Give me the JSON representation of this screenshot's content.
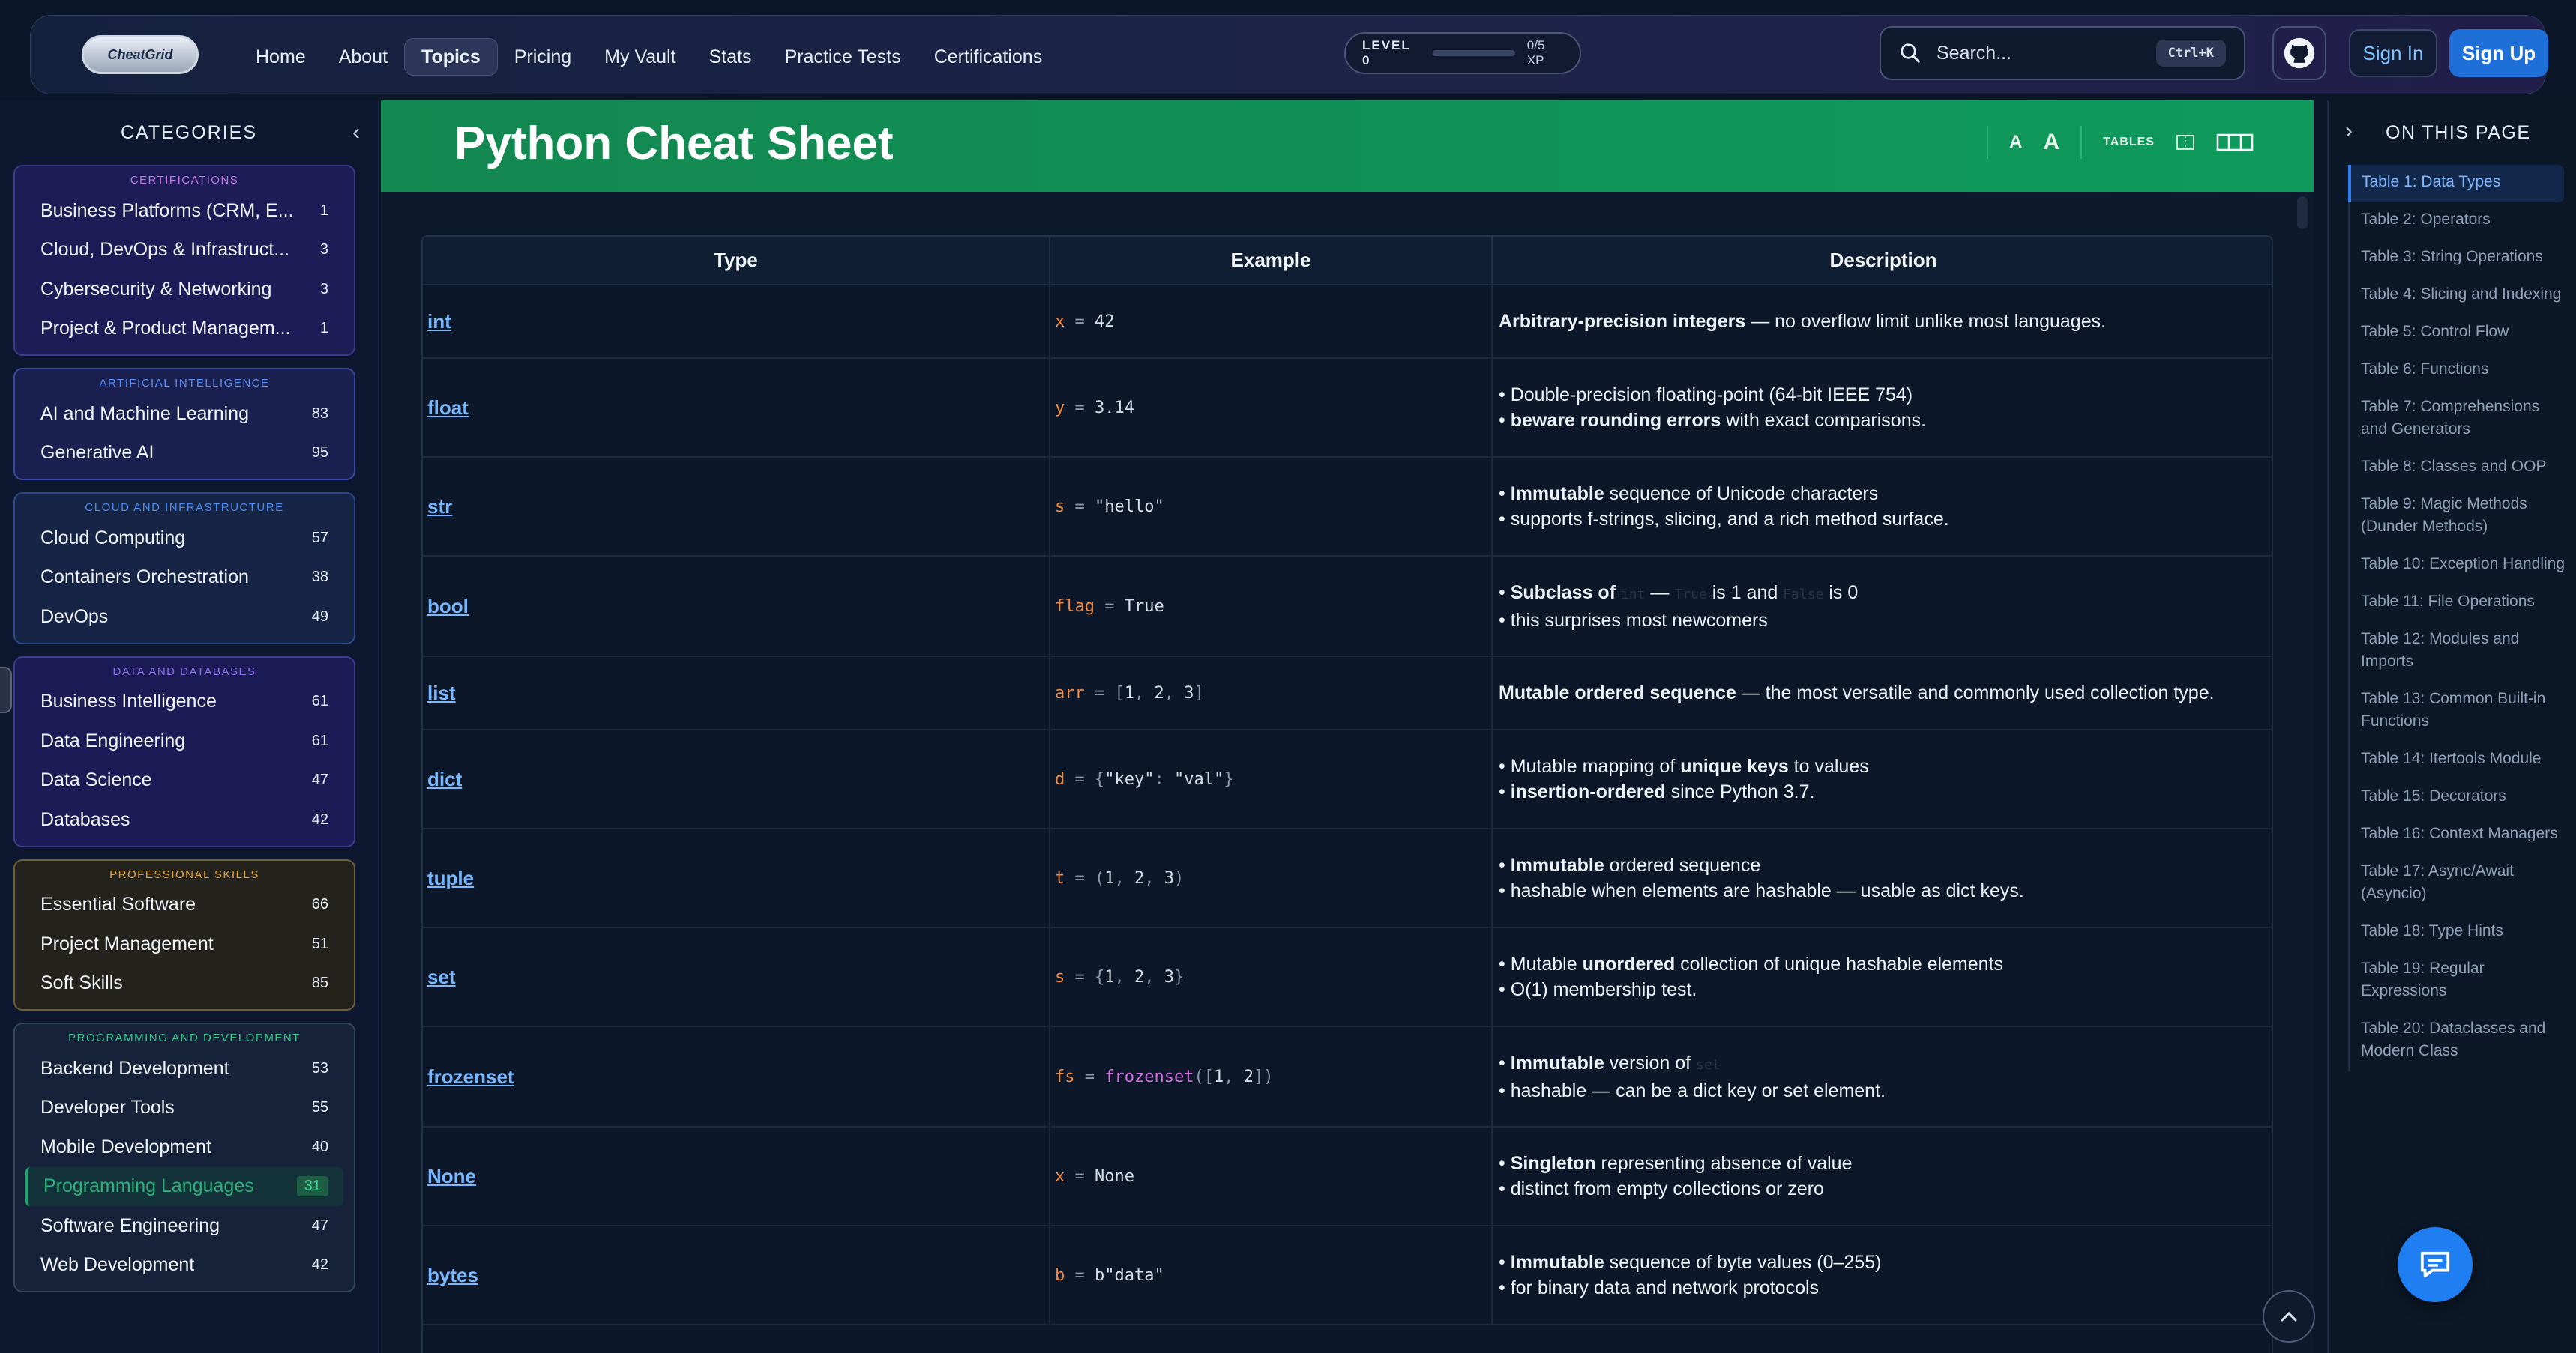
{
  "nav": {
    "logo_text": "CheatGrid",
    "links": [
      {
        "label": "Home",
        "active": false
      },
      {
        "label": "About",
        "active": false
      },
      {
        "label": "Topics",
        "active": true
      },
      {
        "label": "Pricing",
        "active": false
      },
      {
        "label": "My Vault",
        "active": false
      },
      {
        "label": "Stats",
        "active": false
      },
      {
        "label": "Practice Tests",
        "active": false
      },
      {
        "label": "Certifications",
        "active": false
      }
    ],
    "level_label": "LEVEL 0",
    "xp_label": "0/5 XP",
    "xp_progress": 0,
    "search_placeholder": "Search...",
    "search_shortcut": "Ctrl+K",
    "signin_label": "Sign In",
    "signup_label": "Sign Up"
  },
  "sidebar": {
    "title": "CATEGORIES",
    "groups": [
      {
        "title": "CERTIFICATIONS",
        "items": [
          {
            "name": "Business Platforms (CRM, E...",
            "count": "1"
          },
          {
            "name": "Cloud, DevOps & Infrastruct...",
            "count": "3"
          },
          {
            "name": "Cybersecurity & Networking",
            "count": "3"
          },
          {
            "name": "Project & Product Managem...",
            "count": "1"
          }
        ]
      },
      {
        "title": "ARTIFICIAL INTELLIGENCE",
        "items": [
          {
            "name": "AI and Machine Learning",
            "count": "83"
          },
          {
            "name": "Generative AI",
            "count": "95"
          }
        ]
      },
      {
        "title": "CLOUD AND INFRASTRUCTURE",
        "items": [
          {
            "name": "Cloud Computing",
            "count": "57"
          },
          {
            "name": "Containers Orchestration",
            "count": "38"
          },
          {
            "name": "DevOps",
            "count": "49"
          }
        ]
      },
      {
        "title": "DATA AND DATABASES",
        "items": [
          {
            "name": "Business Intelligence",
            "count": "61"
          },
          {
            "name": "Data Engineering",
            "count": "61"
          },
          {
            "name": "Data Science",
            "count": "47"
          },
          {
            "name": "Databases",
            "count": "42"
          }
        ]
      },
      {
        "title": "PROFESSIONAL SKILLS",
        "items": [
          {
            "name": "Essential Software",
            "count": "66"
          },
          {
            "name": "Project Management",
            "count": "51"
          },
          {
            "name": "Soft Skills",
            "count": "85"
          }
        ]
      },
      {
        "title": "PROGRAMMING AND DEVELOPMENT",
        "items": [
          {
            "name": "Backend Development",
            "count": "53"
          },
          {
            "name": "Developer Tools",
            "count": "55"
          },
          {
            "name": "Mobile Development",
            "count": "40"
          },
          {
            "name": "Programming Languages",
            "count": "31",
            "selected": true
          },
          {
            "name": "Software Engineering",
            "count": "47"
          },
          {
            "name": "Web Development",
            "count": "42"
          }
        ]
      }
    ]
  },
  "main": {
    "title": "Python Cheat Sheet",
    "font_small": "A",
    "font_large": "A",
    "tables_label": "TABLES",
    "table": {
      "headers": [
        "Type",
        "Example",
        "Description"
      ],
      "rows": [
        {
          "type": "int",
          "ex": [
            [
              "v",
              "x"
            ],
            [
              "p",
              " = "
            ],
            [
              "t",
              "42"
            ]
          ],
          "desc": [
            [
              {
                "b": "Arbitrary-precision integers"
              },
              {
                "t": " — no overflow limit unlike most languages."
              }
            ]
          ],
          "plain": true
        },
        {
          "type": "float",
          "ex": [
            [
              "v",
              "y"
            ],
            [
              "p",
              " = "
            ],
            [
              "t",
              "3.14"
            ]
          ],
          "desc": [
            [
              {
                "t": "• Double-precision floating-point (64-bit IEEE 754)"
              }
            ],
            [
              {
                "t": "• "
              },
              {
                "b": "beware rounding errors"
              },
              {
                "t": " with exact comparisons."
              }
            ]
          ]
        },
        {
          "type": "str",
          "ex": [
            [
              "v",
              "s"
            ],
            [
              "p",
              " = "
            ],
            [
              "t",
              "\"hello\""
            ]
          ],
          "desc": [
            [
              {
                "t": "• "
              },
              {
                "b": "Immutable"
              },
              {
                "t": " sequence of Unicode characters"
              }
            ],
            [
              {
                "t": "• supports f-strings, slicing, and a rich method surface."
              }
            ]
          ]
        },
        {
          "type": "bool",
          "ex": [
            [
              "v",
              "flag"
            ],
            [
              "p",
              " = "
            ],
            [
              "t",
              "True"
            ]
          ],
          "desc": [
            [
              {
                "t": "• "
              },
              {
                "b": "Subclass of "
              },
              {
                "c": "int"
              },
              {
                "t": " — "
              },
              {
                "c": "True"
              },
              {
                "t": " is 1 and "
              },
              {
                "c": "False"
              },
              {
                "t": " is 0"
              }
            ],
            [
              {
                "t": "• this surprises most newcomers"
              }
            ]
          ]
        },
        {
          "type": "list",
          "ex": [
            [
              "v",
              "arr"
            ],
            [
              "p",
              " = ["
            ],
            [
              "t",
              "1"
            ],
            [
              "p",
              ", "
            ],
            [
              "t",
              "2"
            ],
            [
              "p",
              ", "
            ],
            [
              "t",
              "3"
            ],
            [
              "p",
              "]"
            ]
          ],
          "desc": [
            [
              {
                "b": "Mutable ordered sequence"
              },
              {
                "t": " — the most versatile and commonly used collection type."
              }
            ]
          ],
          "plain": true
        },
        {
          "type": "dict",
          "ex": [
            [
              "v",
              "d"
            ],
            [
              "p",
              " = {"
            ],
            [
              "t",
              "\"key\""
            ],
            [
              "p",
              ": "
            ],
            [
              "t",
              "\"val\""
            ],
            [
              "p",
              "}"
            ]
          ],
          "desc": [
            [
              {
                "t": "• Mutable mapping of "
              },
              {
                "b": "unique keys"
              },
              {
                "t": " to values"
              }
            ],
            [
              {
                "t": "• "
              },
              {
                "b": "insertion-ordered"
              },
              {
                "t": " since Python 3.7."
              }
            ]
          ]
        },
        {
          "type": "tuple",
          "ex": [
            [
              "v",
              "t"
            ],
            [
              "p",
              " = ("
            ],
            [
              "t",
              "1"
            ],
            [
              "p",
              ", "
            ],
            [
              "t",
              "2"
            ],
            [
              "p",
              ", "
            ],
            [
              "t",
              "3"
            ],
            [
              "p",
              ")"
            ]
          ],
          "desc": [
            [
              {
                "t": "• "
              },
              {
                "b": "Immutable"
              },
              {
                "t": " ordered sequence"
              }
            ],
            [
              {
                "t": "• hashable when elements are hashable — usable as dict keys."
              }
            ]
          ]
        },
        {
          "type": "set",
          "ex": [
            [
              "v",
              "s"
            ],
            [
              "p",
              " = {"
            ],
            [
              "t",
              "1"
            ],
            [
              "p",
              ", "
            ],
            [
              "t",
              "2"
            ],
            [
              "p",
              ", "
            ],
            [
              "t",
              "3"
            ],
            [
              "p",
              "}"
            ]
          ],
          "desc": [
            [
              {
                "t": "• Mutable "
              },
              {
                "b": "unordered"
              },
              {
                "t": " collection of unique hashable elements"
              }
            ],
            [
              {
                "t": "• O(1) membership test."
              }
            ]
          ]
        },
        {
          "type": "frozenset",
          "ex": [
            [
              "v",
              "fs"
            ],
            [
              "p",
              " = "
            ],
            [
              "f",
              "frozenset"
            ],
            [
              "p",
              "(["
            ],
            [
              "t",
              "1"
            ],
            [
              "p",
              ", "
            ],
            [
              "t",
              "2"
            ],
            [
              "p",
              "])"
            ]
          ],
          "desc": [
            [
              {
                "t": "• "
              },
              {
                "b": "Immutable"
              },
              {
                "t": " version of "
              },
              {
                "c": "set"
              }
            ],
            [
              {
                "t": "• hashable — can be a dict key or set element."
              }
            ]
          ]
        },
        {
          "type": "None",
          "ex": [
            [
              "v",
              "x"
            ],
            [
              "p",
              " = "
            ],
            [
              "t",
              "None"
            ]
          ],
          "desc": [
            [
              {
                "t": "• "
              },
              {
                "b": "Singleton"
              },
              {
                "t": " representing absence of value"
              }
            ],
            [
              {
                "t": "• distinct from empty collections or zero"
              }
            ]
          ]
        },
        {
          "type": "bytes",
          "ex": [
            [
              "v",
              "b"
            ],
            [
              "p",
              " = "
            ],
            [
              "t",
              "b\"data\""
            ]
          ],
          "desc": [
            [
              {
                "t": "• "
              },
              {
                "b": "Immutable"
              },
              {
                "t": " sequence of byte values (0–255)"
              }
            ],
            [
              {
                "t": "• for binary data and network protocols"
              }
            ]
          ]
        }
      ]
    }
  },
  "toc": {
    "title": "ON THIS PAGE",
    "items": [
      {
        "label": "Table 1: Data Types",
        "active": true
      },
      {
        "label": "Table 2: Operators"
      },
      {
        "label": "Table 3: String Operations"
      },
      {
        "label": "Table 4: Slicing and Indexing"
      },
      {
        "label": "Table 5: Control Flow"
      },
      {
        "label": "Table 6: Functions"
      },
      {
        "label": "Table 7: Comprehensions and Generators"
      },
      {
        "label": "Table 8: Classes and OOP"
      },
      {
        "label": "Table 9: Magic Methods (Dunder Methods)"
      },
      {
        "label": "Table 10: Exception Handling"
      },
      {
        "label": "Table 11: File Operations"
      },
      {
        "label": "Table 12: Modules and Imports"
      },
      {
        "label": "Table 13: Common Built-in Functions"
      },
      {
        "label": "Table 14: Itertools Module"
      },
      {
        "label": "Table 15: Decorators"
      },
      {
        "label": "Table 16: Context Managers"
      },
      {
        "label": "Table 17: Async/Await (Asyncio)"
      },
      {
        "label": "Table 18: Type Hints"
      },
      {
        "label": "Table 19: Regular Expressions"
      },
      {
        "label": "Table 20: Dataclasses and Modern Class"
      }
    ]
  },
  "colors": {
    "accent_green": "#0f9a5c",
    "link_blue": "#79b8ff",
    "primary_button": "#1f6fd8"
  }
}
